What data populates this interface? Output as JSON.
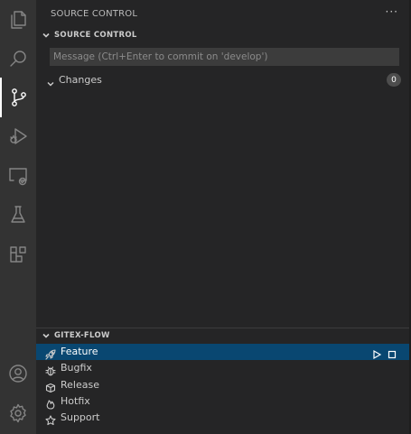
{
  "activity_bar": {
    "items": [
      {
        "name": "explorer",
        "icon": "files-icon"
      },
      {
        "name": "search",
        "icon": "search-icon"
      },
      {
        "name": "source-control",
        "icon": "source-control-icon",
        "active": true
      },
      {
        "name": "run-debug",
        "icon": "run-debug-icon"
      },
      {
        "name": "remote-explorer",
        "icon": "remote-explorer-icon"
      },
      {
        "name": "testing",
        "icon": "beaker-icon"
      },
      {
        "name": "extensions",
        "icon": "extensions-icon"
      },
      {
        "name": "accounts",
        "icon": "account-icon"
      },
      {
        "name": "manage",
        "icon": "gear-icon"
      }
    ]
  },
  "sidebar": {
    "title": "SOURCE CONTROL",
    "more_label": "···",
    "scm_section": {
      "label": "SOURCE CONTROL",
      "commit_placeholder": "Message (Ctrl+Enter to commit on 'develop')",
      "changes_label": "Changes",
      "changes_count": "0"
    },
    "gitflow_section": {
      "label": "GITEX-FLOW",
      "items": [
        {
          "label": "Feature",
          "icon": "rocket-icon",
          "selected": true
        },
        {
          "label": "Bugfix",
          "icon": "bug-icon"
        },
        {
          "label": "Release",
          "icon": "package-icon"
        },
        {
          "label": "Hotfix",
          "icon": "flame-icon"
        },
        {
          "label": "Support",
          "icon": "star-icon"
        }
      ]
    }
  },
  "colors": {
    "activity_bar_bg": "#333333",
    "sidebar_bg": "#252526",
    "selection_bg": "#094771",
    "input_bg": "#3c3c3c",
    "badge_bg": "#4d4d4d"
  }
}
